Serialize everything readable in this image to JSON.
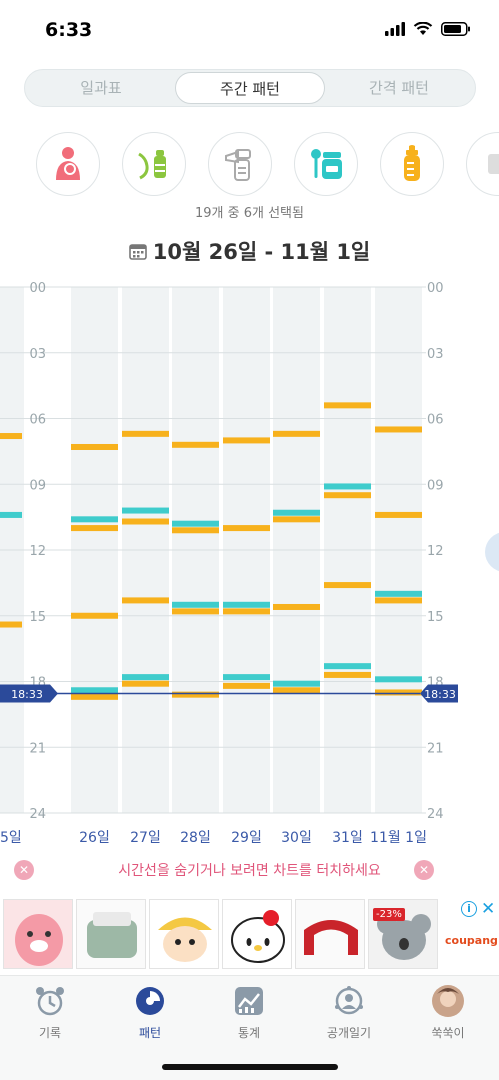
{
  "status": {
    "time": "6:33"
  },
  "tabs": [
    {
      "label": "일과표",
      "active": false
    },
    {
      "label": "주간 패턴",
      "active": true
    },
    {
      "label": "간격 패턴",
      "active": false
    }
  ],
  "filters": {
    "icons": [
      "breastfeeding-icon",
      "pumped-milk-bottle-icon",
      "breast-pump-icon",
      "baby-food-jar-icon",
      "formula-bottle-icon",
      "more-category-icon"
    ],
    "selected_count": "19개 중 6개 선택됨"
  },
  "date_range": "10월 26일 - 11월 1일",
  "chart_data": {
    "type": "timeline",
    "hour_ticks": [
      "00",
      "03",
      "06",
      "09",
      "12",
      "15",
      "18",
      "21",
      "24"
    ],
    "ylim": [
      0,
      24
    ],
    "day_labels": [
      "26일",
      "27일",
      "28일",
      "29일",
      "30일",
      "31일",
      "11월 1일"
    ],
    "partial_prev_day_label": "5일",
    "current_time_label": "18:33",
    "current_time_hours": 18.55,
    "colors": {
      "orange": "#f7b11c",
      "teal": "#3fcccc",
      "line": "#2b4a9a"
    },
    "events": [
      {
        "day": "26일",
        "orange": [
          7.3,
          11.0,
          15.0,
          18.7
        ],
        "teal": [
          10.6,
          18.4
        ]
      },
      {
        "day": "27일",
        "orange": [
          6.7,
          10.7,
          14.3,
          18.1
        ],
        "teal": [
          10.2,
          17.8
        ]
      },
      {
        "day": "28일",
        "orange": [
          7.2,
          11.1,
          14.8,
          18.6
        ],
        "teal": [
          10.8,
          14.5
        ]
      },
      {
        "day": "29일",
        "orange": [
          7.0,
          11.0,
          14.8,
          18.2
        ],
        "teal": [
          14.5,
          17.8
        ]
      },
      {
        "day": "30일",
        "orange": [
          6.7,
          10.6,
          14.6,
          18.4
        ],
        "teal": [
          10.3,
          18.1
        ]
      },
      {
        "day": "31일",
        "orange": [
          5.4,
          9.5,
          13.6,
          17.7
        ],
        "teal": [
          9.1,
          17.3
        ]
      },
      {
        "day": "11월 1일",
        "orange": [
          6.5,
          10.4,
          14.3,
          18.5
        ],
        "teal": [
          14.0,
          17.9
        ]
      }
    ],
    "prev_day_events": {
      "orange": [
        6.8,
        15.4
      ],
      "teal": [
        10.4,
        18.8
      ]
    }
  },
  "hint": "시간선을 숨기거나 보려면 차트를 터치하세요",
  "ad": {
    "brand": "coupang",
    "discount": "-23%"
  },
  "bottom_nav": [
    {
      "label": "기록",
      "icon": "alarm-clock-icon",
      "active": false
    },
    {
      "label": "패턴",
      "icon": "pattern-chart-icon",
      "active": true
    },
    {
      "label": "통계",
      "icon": "statistics-icon",
      "active": false
    },
    {
      "label": "공개일기",
      "icon": "public-diary-icon",
      "active": false
    },
    {
      "label": "쑥쑥이",
      "icon": "profile-avatar-icon",
      "active": false
    }
  ]
}
